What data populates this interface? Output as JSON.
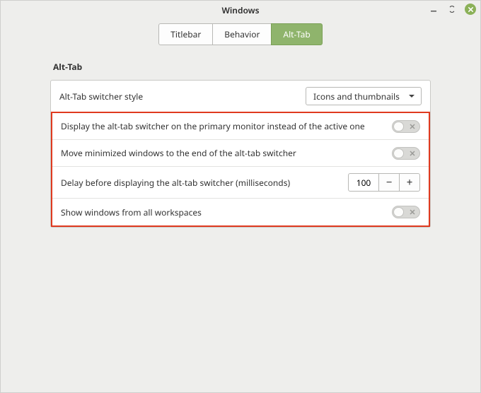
{
  "window": {
    "title": "Windows"
  },
  "tabs": {
    "t0": "Titlebar",
    "t1": "Behavior",
    "t2": "Alt-Tab"
  },
  "section": {
    "heading": "Alt-Tab"
  },
  "rows": {
    "style_label": "Alt-Tab switcher style",
    "style_value": "Icons and thumbnails",
    "primary_monitor_label": "Display the alt-tab switcher on the primary monitor instead of the active one",
    "move_min_label": "Move minimized windows to the end of the alt-tab switcher",
    "delay_label": "Delay before displaying the alt-tab switcher (milliseconds)",
    "delay_value": "100",
    "show_all_label": "Show windows from all workspaces"
  },
  "toggles": {
    "primary_monitor": false,
    "move_min": false,
    "show_all": false
  }
}
